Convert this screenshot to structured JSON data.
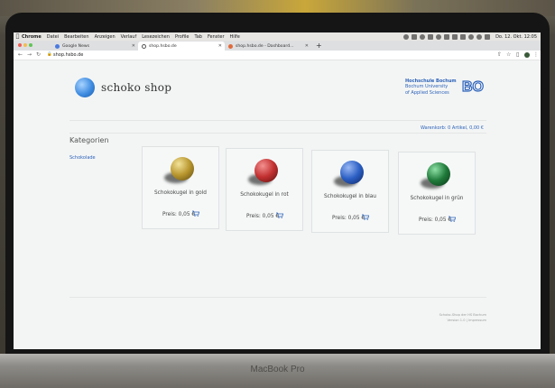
{
  "menubar": {
    "app": "Chrome",
    "items": [
      "Datei",
      "Bearbeiten",
      "Anzeigen",
      "Verlauf",
      "Lesezeichen",
      "Profile",
      "Tab",
      "Fenster",
      "Hilfe"
    ],
    "clock": "Do. 12. Okt. 12:05"
  },
  "tabs": [
    {
      "label": "Google News",
      "favicon_color": "#4a7be0"
    },
    {
      "label": "shop.hsbo.de",
      "favicon_color": "#555555"
    },
    {
      "label": "shop.hsbo.de - Dashboard...",
      "favicon_color": "#e06a3a"
    }
  ],
  "address": {
    "url": "shop.hsbo.de"
  },
  "header": {
    "shop_name": "schoko shop",
    "hs_name": "Hochschule Bochum",
    "hs_en1": "Bochum University",
    "hs_en2": "of Applied Sciences",
    "hs_logo": "BO"
  },
  "cart": {
    "text": "Warenkorb: 0 Artikel, 0,00 €"
  },
  "sidebar": {
    "heading": "Kategorien",
    "items": [
      {
        "label": "Schokolade"
      }
    ]
  },
  "products": [
    {
      "name": "Schokokugel in gold",
      "price": "Preis: 0,05 €",
      "color": "#b8962e",
      "icon": "cart-icon"
    },
    {
      "name": "Schokokugel in rot",
      "price": "Preis: 0,05 €",
      "color": "#c23030",
      "icon": "cart-icon"
    },
    {
      "name": "Schokokugel in blau",
      "price": "Preis: 0,05 €",
      "color": "#2b5fc4",
      "icon": "cart-icon"
    },
    {
      "name": "Schokokugel in grün",
      "price": "Preis: 0,05 €",
      "color": "#1f7a3a",
      "icon": "cart-icon"
    }
  ],
  "footer": {
    "line1": "Schoko-Shop der HS Bochum",
    "line2": "Version 1.0 | Impressum"
  },
  "device": {
    "label": "MacBook Pro"
  },
  "colors": {
    "accent": "#2d62b8",
    "page_bg": "#f3f5f5"
  }
}
